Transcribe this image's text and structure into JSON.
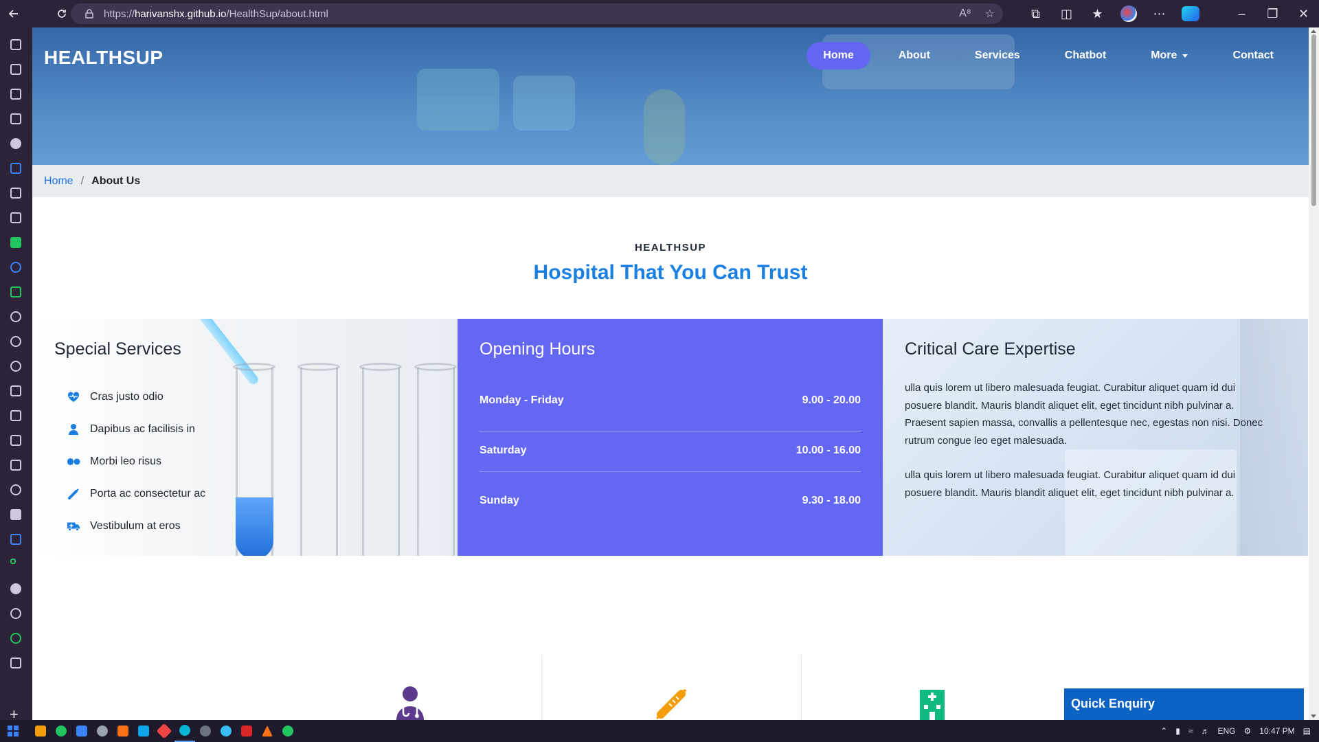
{
  "browser": {
    "url_prefix": "https://",
    "url_domain": "harivanshx.github.io",
    "url_path": "/HealthSup/about.html"
  },
  "site": {
    "brand": "HEALTHSUP",
    "nav": [
      {
        "label": "Home",
        "active": true
      },
      {
        "label": "About"
      },
      {
        "label": "Services"
      },
      {
        "label": "Chatbot"
      },
      {
        "label": "More"
      },
      {
        "label": "Contact"
      }
    ]
  },
  "breadcrumb": {
    "home": "Home",
    "separator": "/",
    "current": "About Us"
  },
  "intro": {
    "subtitle": "HEALTHSUP",
    "title": "Hospital That You Can Trust"
  },
  "special_services": {
    "heading": "Special Services",
    "items": [
      {
        "icon": "heart-pulse-icon",
        "label": "Cras justo odio"
      },
      {
        "icon": "user-doctor-icon",
        "label": "Dapibus ac facilisis in"
      },
      {
        "icon": "pills-icon",
        "label": "Morbi leo risus"
      },
      {
        "icon": "syringe-icon",
        "label": "Porta ac consectetur ac"
      },
      {
        "icon": "ambulance-icon",
        "label": "Vestibulum at eros"
      }
    ]
  },
  "opening_hours": {
    "heading": "Opening Hours",
    "rows": [
      {
        "day": "Monday - Friday",
        "hours": "9.00 - 20.00"
      },
      {
        "day": "Saturday",
        "hours": "10.00 - 16.00"
      },
      {
        "day": "Sunday",
        "hours": "9.30 - 18.00"
      }
    ]
  },
  "critical_care": {
    "heading": "Critical Care Expertise",
    "paragraphs": [
      "ulla quis lorem ut libero malesuada feugiat. Curabitur aliquet quam id dui posuere blandit. Mauris blandit aliquet elit, eget tincidunt nibh pulvinar a. Praesent sapien massa, convallis a pellentesque nec, egestas non nisi. Donec rutrum congue leo eget malesuada.",
      "ulla quis lorem ut libero malesuada feugiat. Curabitur aliquet quam id dui posuere blandit. Mauris blandit aliquet elit, eget tincidunt nibh pulvinar a."
    ]
  },
  "quick_enquiry": {
    "label": "Quick Enquiry"
  },
  "taskbar": {
    "lang": "ENG",
    "time": "10:47 PM"
  },
  "colors": {
    "accent": "#6366f1",
    "link": "#1a7fe0",
    "enquiry": "#0d63c4"
  }
}
